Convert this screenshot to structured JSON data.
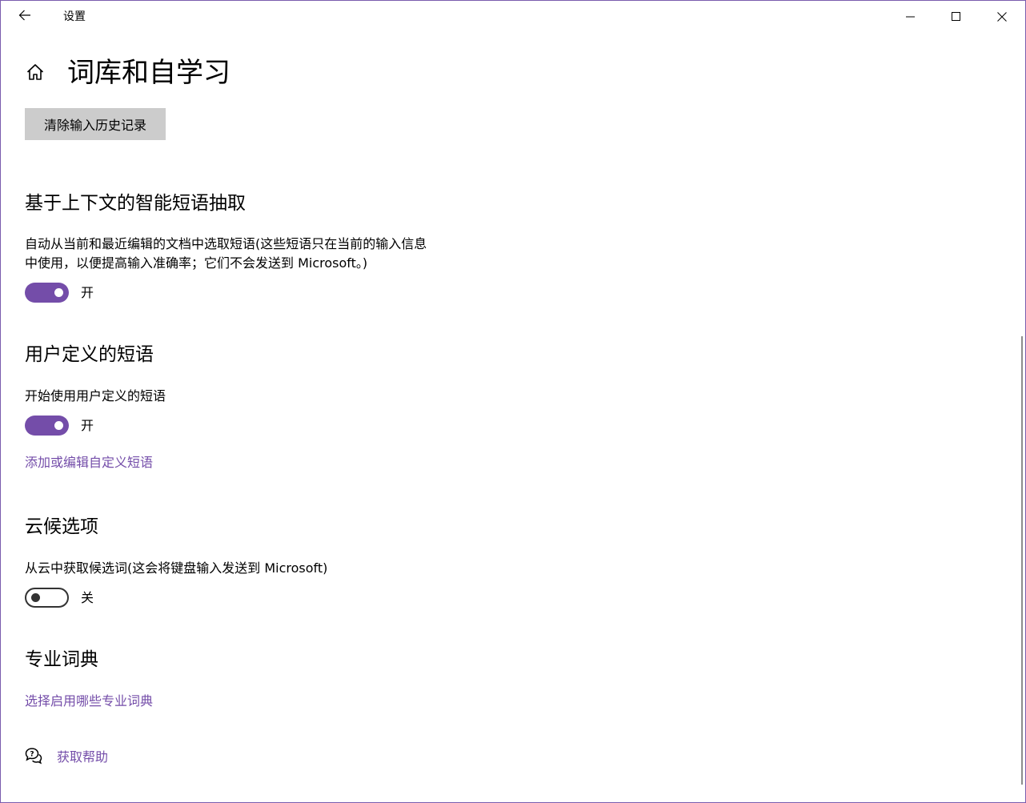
{
  "window": {
    "title": "设置"
  },
  "page": {
    "title": "词库和自学习"
  },
  "clear_history": {
    "label": "清除输入历史记录"
  },
  "sections": {
    "smart_phrase": {
      "heading": "基于上下文的智能短语抽取",
      "desc_line1": "自动从当前和最近编辑的文档中选取短语(这些短语只在当前的输入信息",
      "desc_line2": "中使用，以便提高输入准确率；它们不会发送到 Microsoft。)",
      "toggle_on": true,
      "toggle_state": "开"
    },
    "user_phrases": {
      "heading": "用户定义的短语",
      "desc": "开始使用用户定义的短语",
      "toggle_on": true,
      "toggle_state": "开",
      "link": "添加或编辑自定义短语"
    },
    "cloud": {
      "heading": "云候选项",
      "desc": "从云中获取候选词(这会将键盘输入发送到 Microsoft)",
      "toggle_on": false,
      "toggle_state": "关"
    },
    "dictionaries": {
      "heading": "专业词典",
      "link": "选择启用哪些专业词典"
    }
  },
  "help": {
    "label": "获取帮助",
    "icon": "chat-help-icon"
  },
  "colors": {
    "accent": "#744da9",
    "button_bg": "#cccccc",
    "frame": "#7a5cae"
  }
}
